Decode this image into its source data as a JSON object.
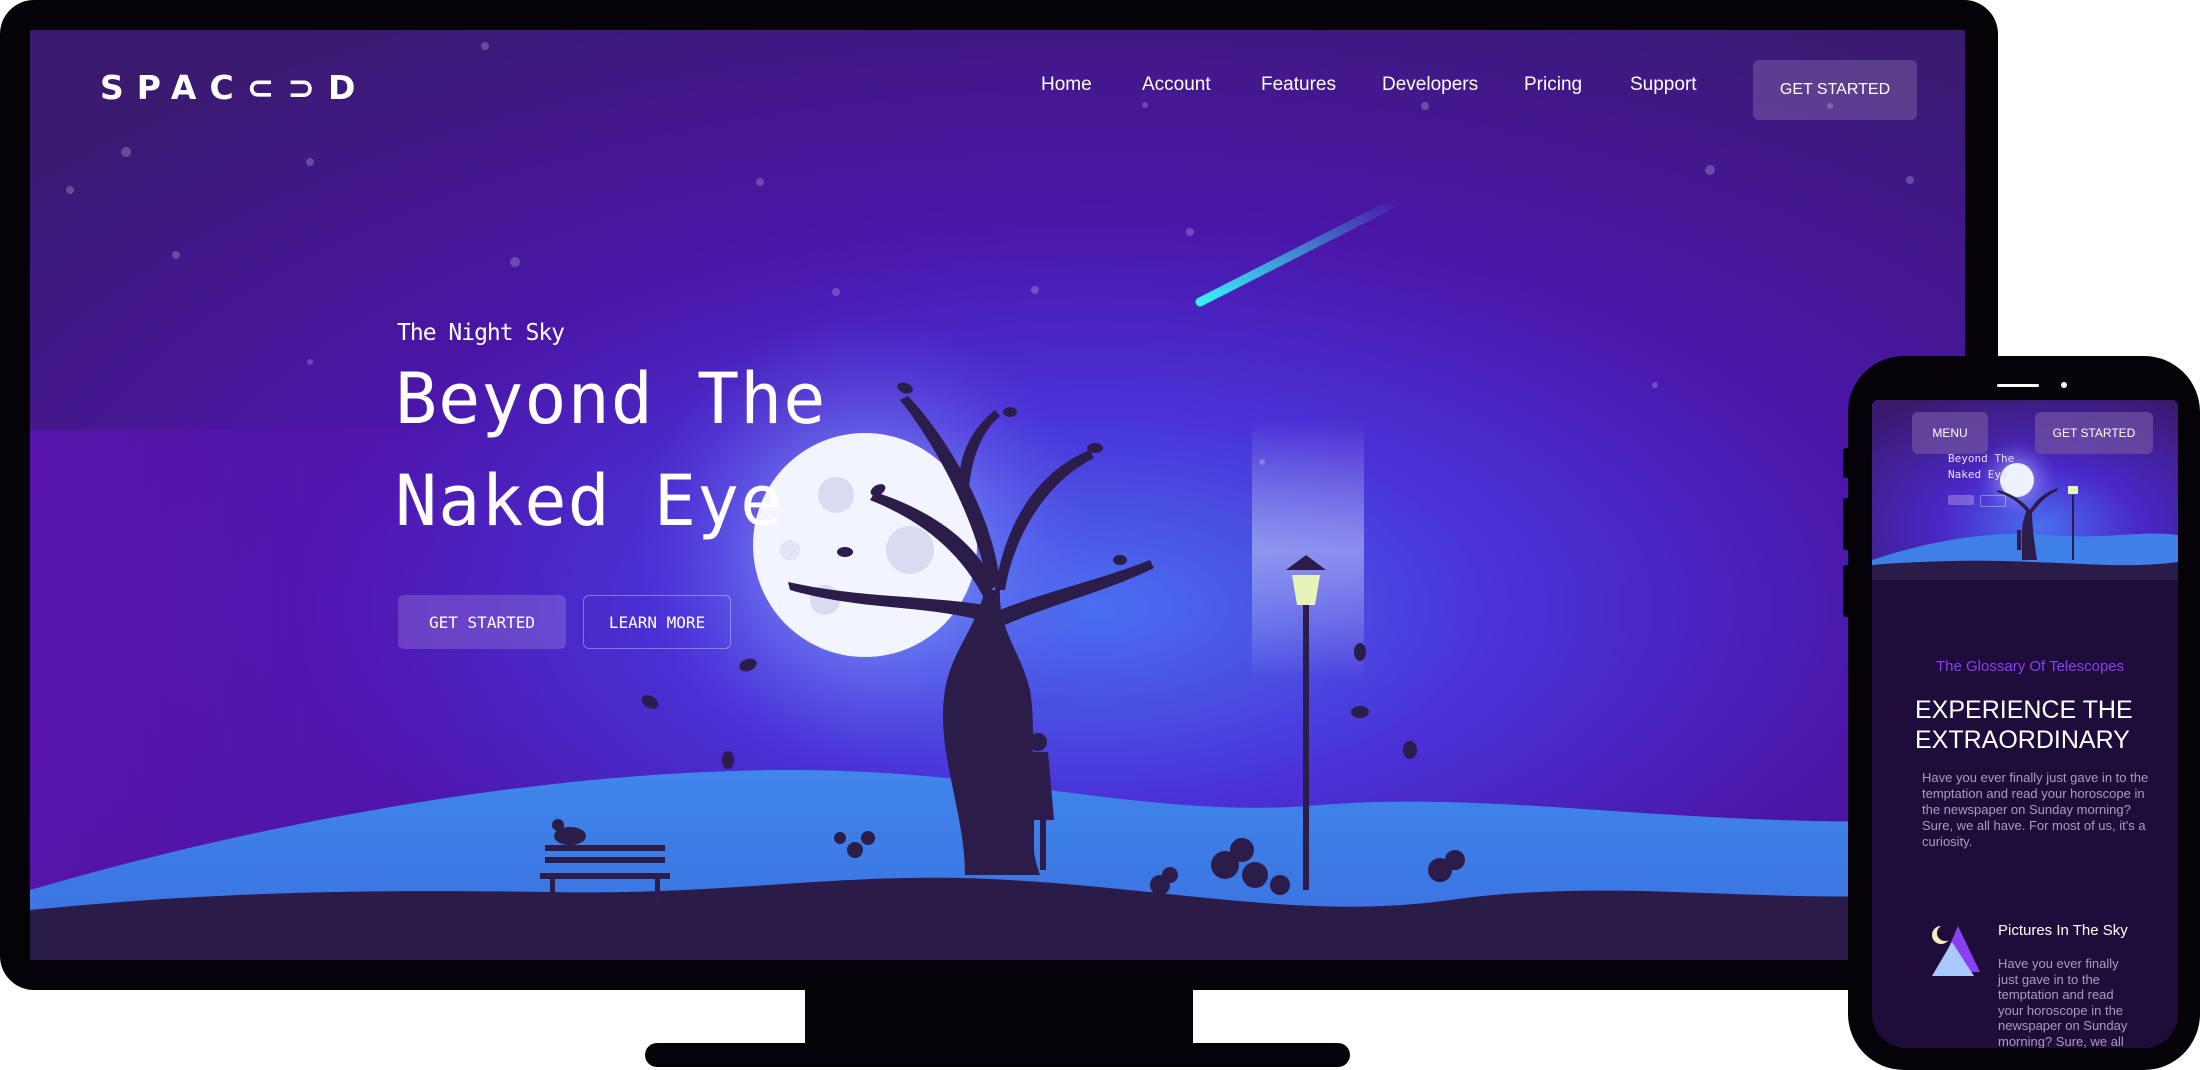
{
  "desktop": {
    "logo": "SPAC⊂⊃D",
    "nav": {
      "items": [
        "Home",
        "Account",
        "Features",
        "Developers",
        "Pricing",
        "Support"
      ],
      "cta": "GET STARTED"
    },
    "hero": {
      "eyebrow": "The Night Sky",
      "title_line1": "Beyond The",
      "title_line2": "Naked Eye",
      "primary_button": "GET STARTED",
      "secondary_button": "LEARN MORE"
    }
  },
  "mobile": {
    "menu_button": "MENU",
    "cta": "GET STARTED",
    "hero_mini_title_line1": "Beyond The",
    "hero_mini_title_line2": "Naked Eye",
    "section_eyebrow": "The Glossary Of Telescopes",
    "section_title_line1": "EXPERIENCE THE",
    "section_title_line2": "EXTRAORDINARY",
    "section_body": "Have you ever finally just gave in to the temptation and read your horoscope in the newspaper on Sunday morning? Sure, we all have. For most of us, it's a curiosity.",
    "feature_title": "Pictures In The Sky",
    "feature_body": "Have you ever finally just gave in to the temptation and read your horoscope in the newspaper on Sunday morning? Sure, we all"
  },
  "colors": {
    "device": "#050308",
    "sky_top": "#3a1a6e",
    "sky_glow": "#3f7fe8",
    "ground": "#2a1a4a",
    "accent_purple": "#7b3ff0",
    "meteor": "#2ee6f0"
  },
  "icons": [
    "moon-icon",
    "tree-icon",
    "lamp-post-icon",
    "bench-icon",
    "telescope-icon",
    "meteor-icon",
    "person-silhouette-icon",
    "bird-icon"
  ]
}
